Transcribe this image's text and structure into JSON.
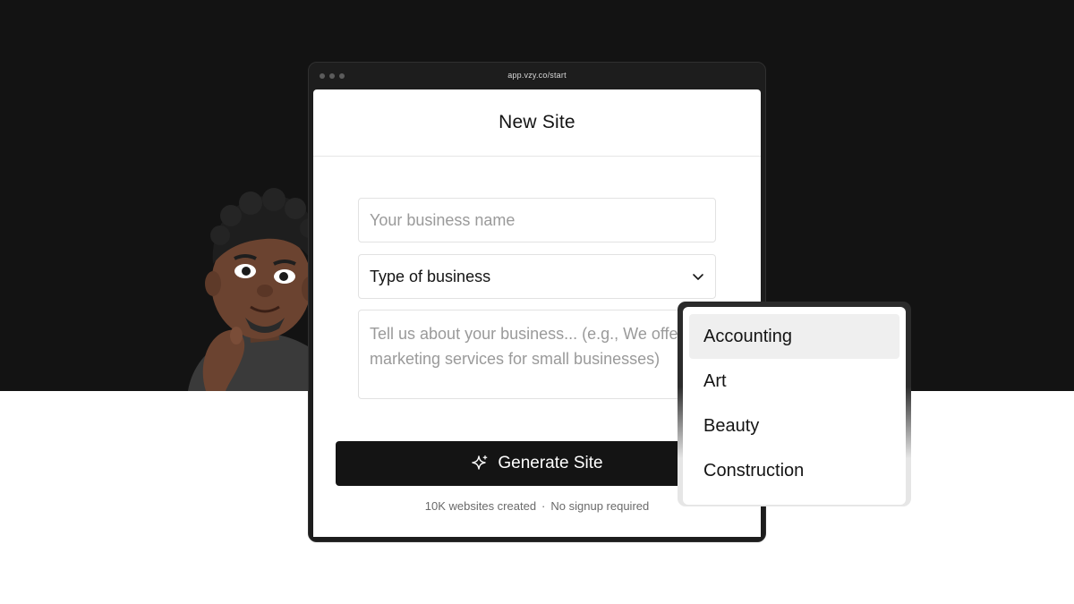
{
  "browser": {
    "url": "app.vzy.co/start"
  },
  "page": {
    "title": "New Site"
  },
  "form": {
    "business_name_placeholder": "Your business name",
    "business_type_value": "Type of business",
    "about_placeholder": "Tell us about your business... (e.g., We offer marketing services for small businesses)",
    "generate_label": "Generate Site"
  },
  "footnote": {
    "left": "10K websites created",
    "separator": "·",
    "right": "No signup required"
  },
  "dropdown": {
    "options": [
      {
        "label": "Accounting"
      },
      {
        "label": "Art"
      },
      {
        "label": "Beauty"
      },
      {
        "label": "Construction"
      }
    ],
    "highlighted_index": 0
  },
  "colors": {
    "background_dark": "#131313",
    "button": "#141414",
    "option_highlight": "#efefef"
  },
  "icons": {
    "chevron": "chevron-down-icon",
    "sparkle": "sparkle-icon",
    "window_controls": "window-dot-icon"
  }
}
